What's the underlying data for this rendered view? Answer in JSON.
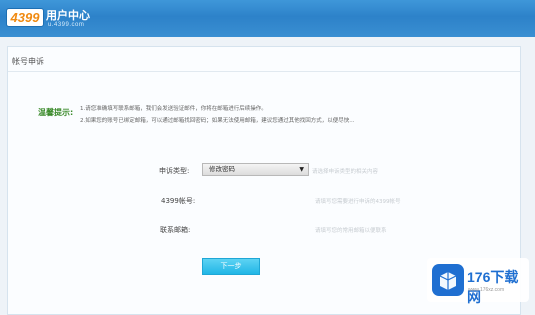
{
  "header": {
    "logo_text": "4399",
    "title": "用户中心",
    "url": "u.4399.com"
  },
  "page": {
    "title": "帐号申诉"
  },
  "tips": {
    "heading": "温馨提示:",
    "line1": "1.请您准确填写联系邮箱，我们会发送验证邮件，你将在邮箱进行后续操作。",
    "line2": "2.如果您的账号已绑定邮箱，可以通过邮箱找回密码；如果无法使用邮箱，建议您通过其他找回方式，以便尽快..."
  },
  "form": {
    "appeal_type_label": "申诉类型:",
    "appeal_type_value": "修改密码",
    "appeal_type_hint": "请选择申诉类型的相关内容",
    "account_label": "4399帐号:",
    "account_value": "",
    "account_hint": "请填写您需要进行申诉的4399帐号",
    "email_label": "联系邮箱:",
    "email_value": "",
    "email_hint": "请填写您的常用邮箱以便联系",
    "next_button": "下一步"
  },
  "watermark": {
    "title": "176下载网",
    "url": "www.176xz.com"
  },
  "colors": {
    "header_blue": "#2d82c9",
    "logo_orange": "#f08a11",
    "tip_green": "#3a8a2a",
    "button_cyan": "#21b6e6"
  }
}
